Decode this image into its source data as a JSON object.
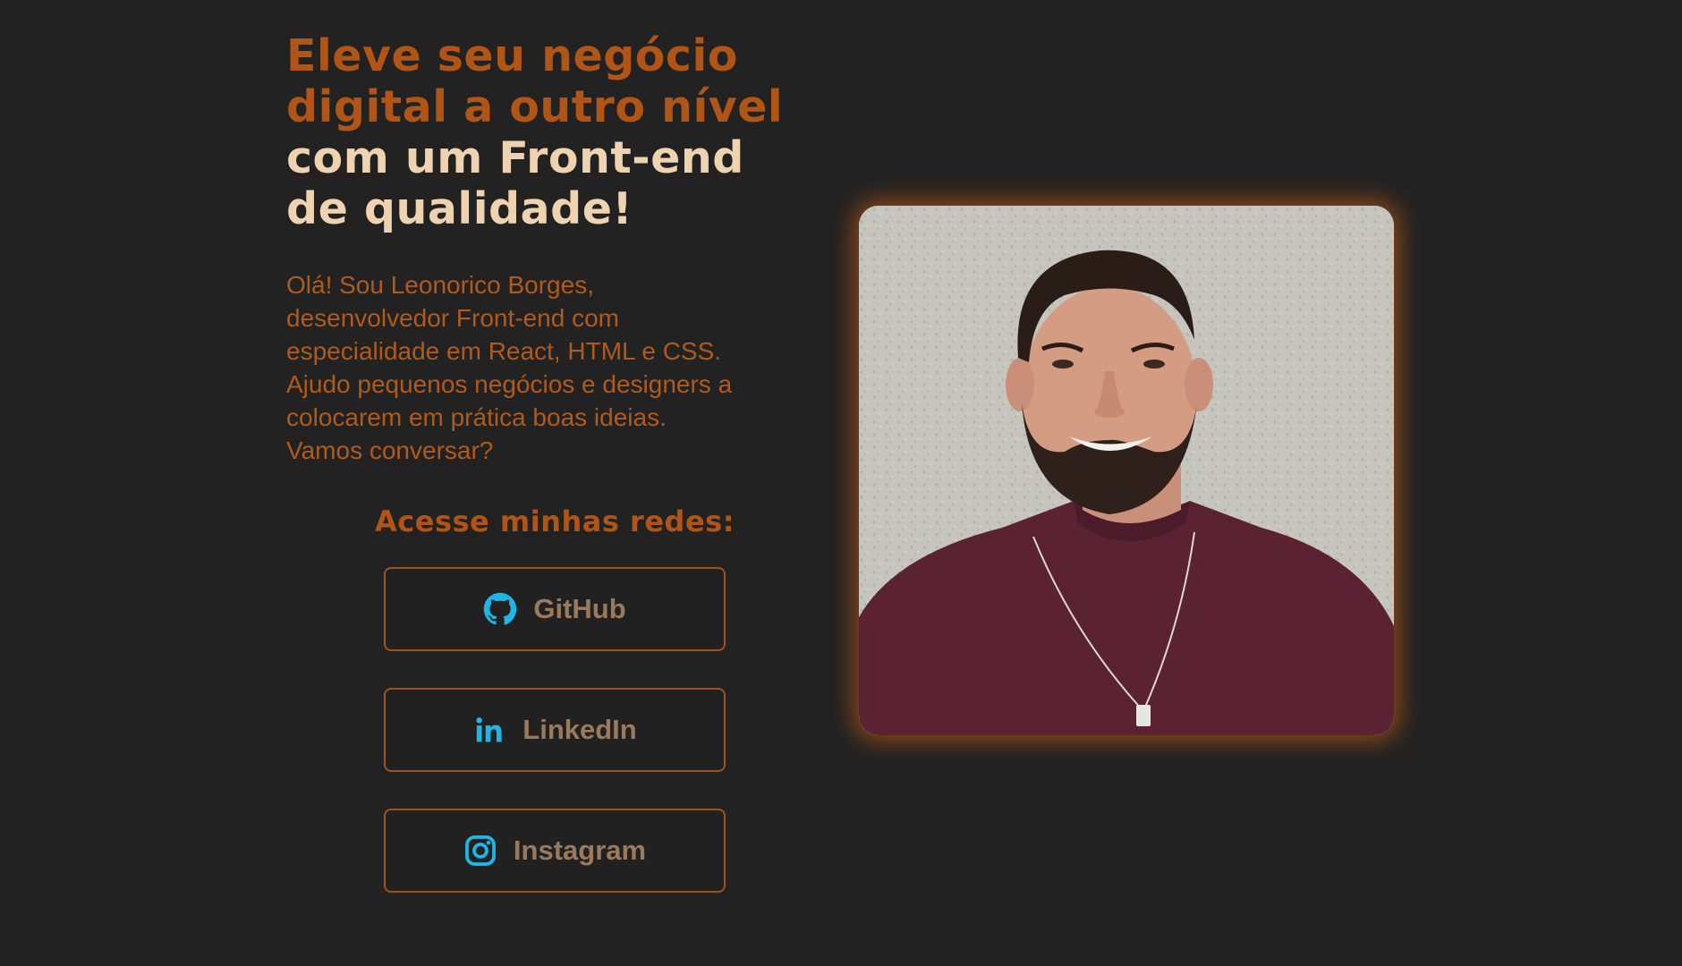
{
  "hero": {
    "headline_accent_1": "Eleve seu negócio",
    "headline_accent_2": "digital a outro nível",
    "headline_light_1": "com um Front-end",
    "headline_light_2": "de qualidade!",
    "intro_lines": [
      "Olá! Sou Leonorico Borges,",
      "desenvolvedor Front-end com",
      "especialidade em React, HTML e CSS.",
      "Ajudo pequenos negócios e designers a",
      "colocarem em prática boas ideias.",
      "Vamos conversar?"
    ]
  },
  "networks": {
    "title": "Acesse minhas redes:",
    "links": [
      {
        "label": "GitHub",
        "icon": "github-icon"
      },
      {
        "label": "LinkedIn",
        "icon": "linkedin-icon"
      },
      {
        "label": "Instagram",
        "icon": "instagram-icon"
      }
    ]
  },
  "profile_photo": {
    "icon": "profile-photo"
  },
  "colors": {
    "background": "#222222",
    "accent": "#b05516",
    "headline_light": "#efd3b0",
    "icon": "#1fb5e6",
    "button_text": "#9a7a5c"
  }
}
